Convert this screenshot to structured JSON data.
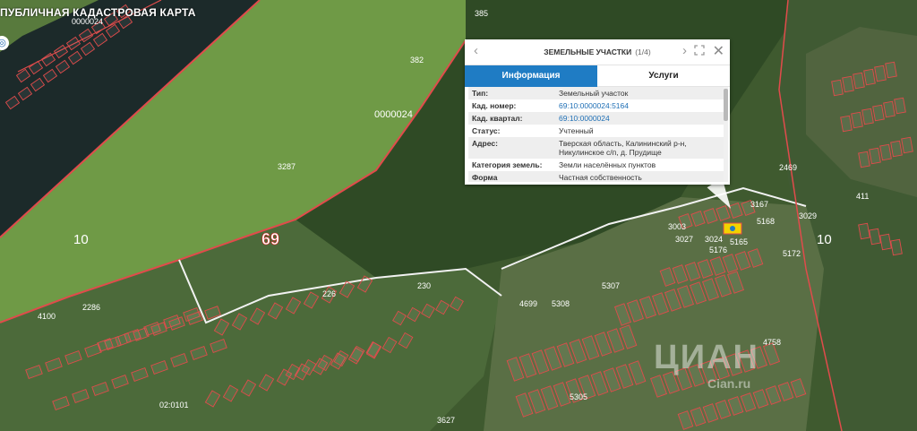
{
  "app": {
    "title": "ПУБЛИЧНАЯ КАДАСТРОВАЯ КАРТА"
  },
  "map": {
    "labels": {
      "quarter_left": "0000024",
      "quarter_mid": "0000024",
      "parcel_385": "385",
      "parcel_382": "382",
      "parcel_3287": "3287",
      "num_10_left": "10",
      "num_69": "69",
      "num_10_right": "10",
      "parcel_2469": "2469",
      "parcel_411": "411",
      "parcel_4100": "4100",
      "parcel_2286": "2286",
      "parcel_226": "226",
      "parcel_230": "230",
      "parcel_5308": "5308",
      "parcel_5307": "5307",
      "parcel_5305": "5305",
      "parcel_3003": "3003",
      "parcel_3027": "3027",
      "parcel_5168": "5168",
      "parcel_5172": "5172",
      "parcel_3029": "3029",
      "parcel_5176": "5176",
      "parcel_5165": "5165",
      "parcel_3024": "3024",
      "parcel_3167": "3167",
      "parcel_4699": "4699",
      "parcel_02_0101": "02:0101",
      "parcel_3627": "3627",
      "parcel_4758": "4758"
    }
  },
  "popup": {
    "title": "ЗЕМЕЛЬНЫЕ УЧАСТКИ",
    "pager": "(1/4)",
    "prev_glyph": "‹",
    "next_glyph": "›",
    "close_glyph": "✕",
    "tabs": [
      {
        "label": "Информация",
        "active": true
      },
      {
        "label": "Услуги",
        "active": false
      }
    ],
    "rows": [
      {
        "key": "Тип:",
        "value": "Земельный участок",
        "link": false
      },
      {
        "key": "Кад. номер:",
        "value": "69:10:0000024:5164",
        "link": true
      },
      {
        "key": "Кад. квартал:",
        "value": "69:10:0000024",
        "link": true
      },
      {
        "key": "Статус:",
        "value": "Учтенный",
        "link": false
      },
      {
        "key": "Адрес:",
        "value": "Тверская область, Калининский р-н, Никулинское с/п, д. Прудище",
        "link": false
      },
      {
        "key": "Категория земель:",
        "value": "Земли населённых пунктов",
        "link": false
      },
      {
        "key": "Форма",
        "value": "Частная собственность",
        "link": false
      }
    ]
  },
  "watermark": {
    "brand": "ЦИАН",
    "sub": "Cian.ru"
  },
  "colors": {
    "accent": "#1f7cc4",
    "parcel_border": "#e14b4b",
    "selected": "#f2d300"
  }
}
